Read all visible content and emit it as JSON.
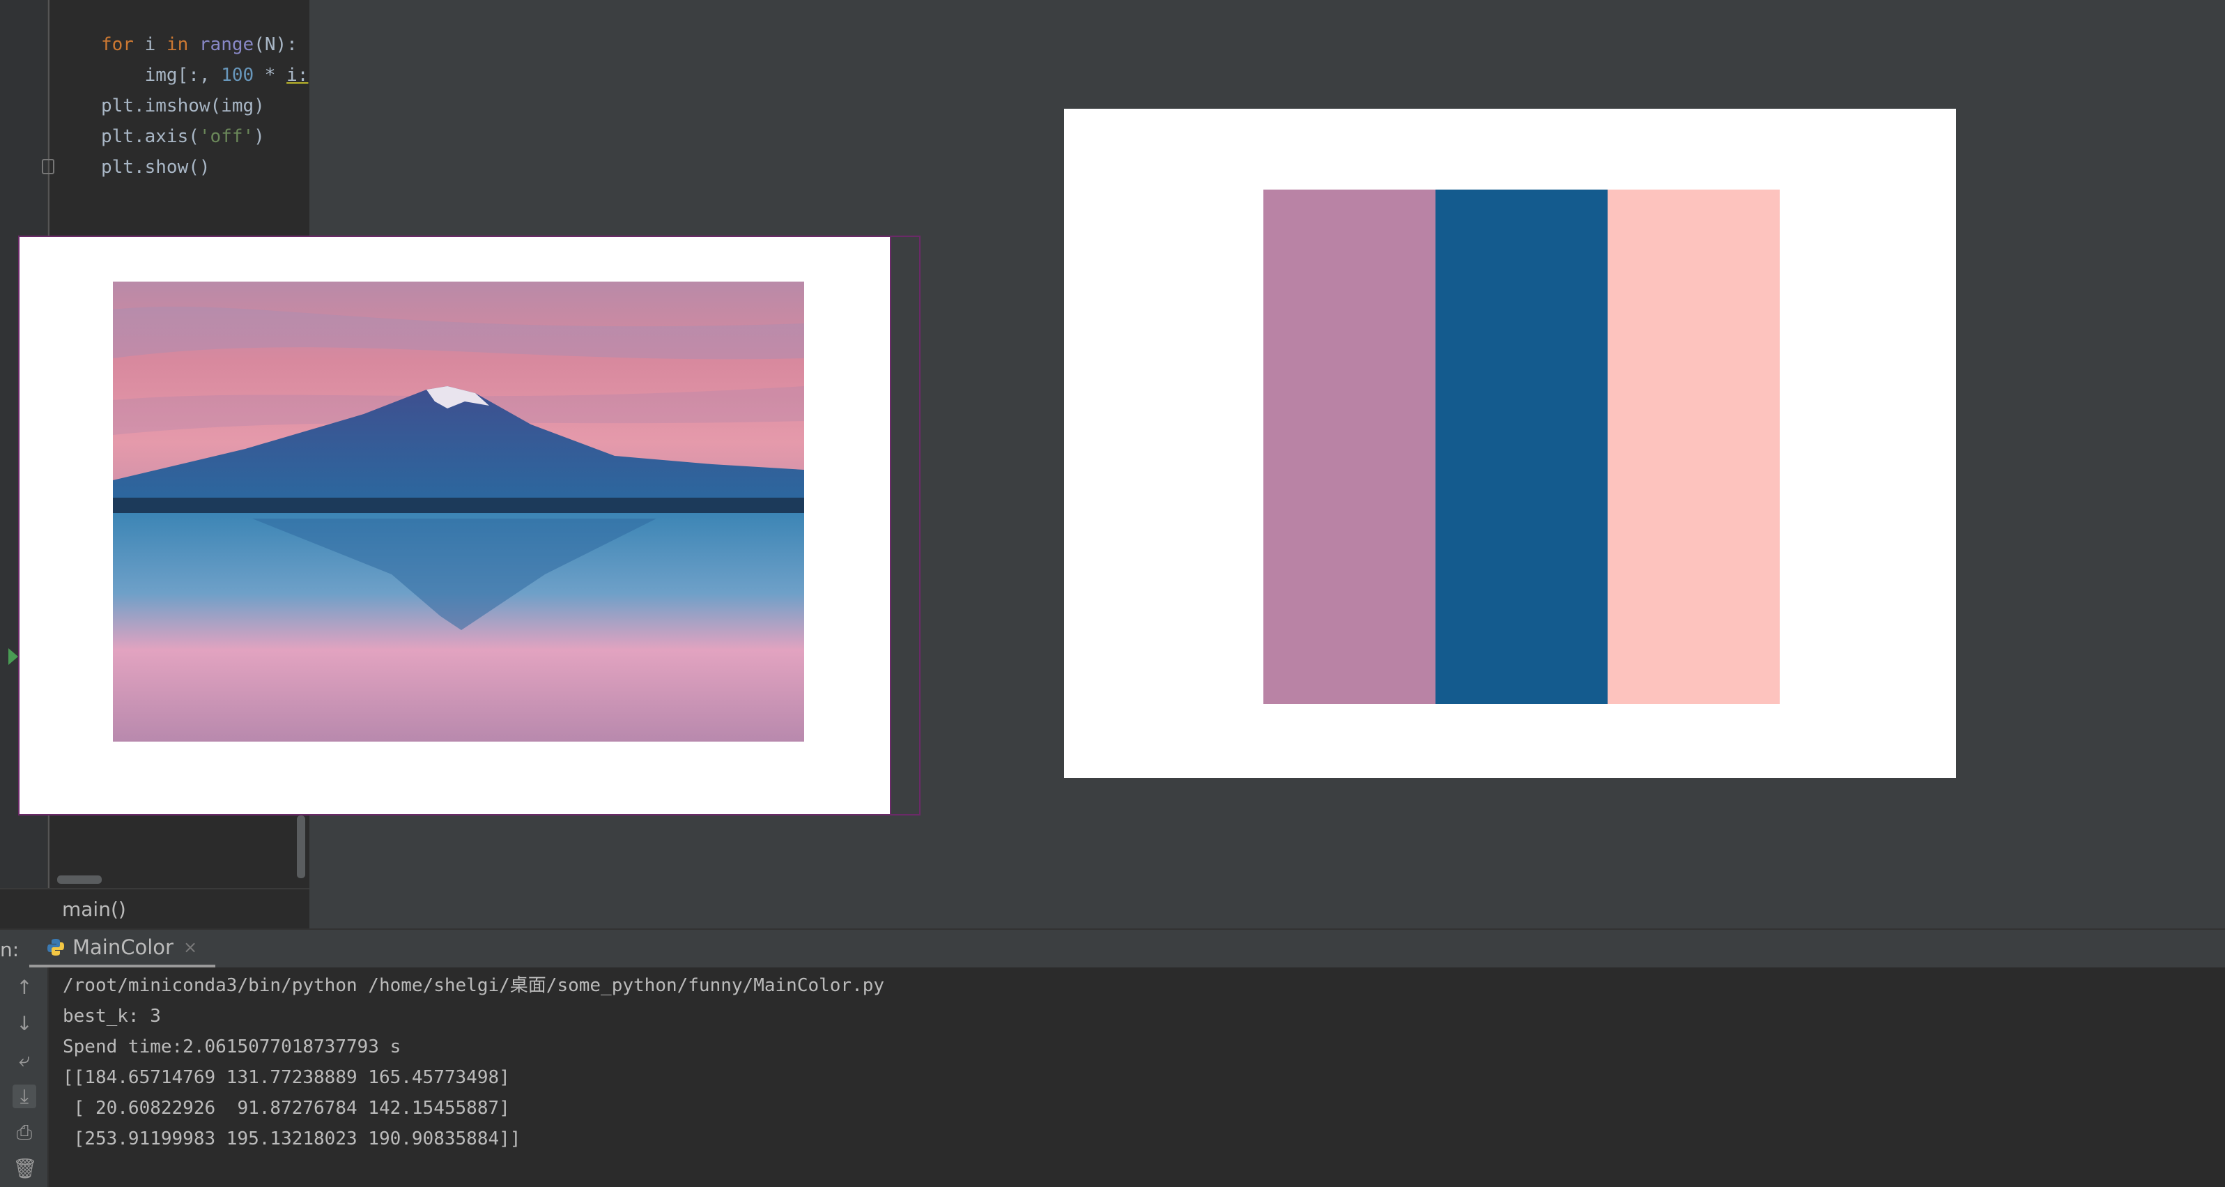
{
  "editor": {
    "code_lines": [
      [
        {
          "t": "for",
          "c": "kw"
        },
        {
          "t": " i ",
          "c": ""
        },
        {
          "t": "in",
          "c": "kw"
        },
        {
          "t": " ",
          "c": ""
        },
        {
          "t": "range",
          "c": "fn"
        },
        {
          "t": "(N):",
          "c": ""
        }
      ],
      [
        {
          "t": "    img[:, ",
          "c": ""
        },
        {
          "t": "100",
          "c": "num"
        },
        {
          "t": " * ",
          "c": ""
        },
        {
          "t": "i:",
          "c": "u"
        }
      ],
      [
        {
          "t": "plt.imshow(img)",
          "c": ""
        }
      ],
      [
        {
          "t": "plt.axis(",
          "c": ""
        },
        {
          "t": "'off'",
          "c": "str"
        },
        {
          "t": ")",
          "c": ""
        }
      ],
      [
        {
          "t": "plt.show()",
          "c": ""
        }
      ]
    ],
    "breadcrumb": "main()"
  },
  "figure_right": {
    "swatches": [
      "#b983a5",
      "#145b8e",
      "#fdc3be"
    ]
  },
  "run": {
    "label": "n:",
    "tab_label": "MainColor",
    "tab_close": "×",
    "console_lines": [
      "/root/miniconda3/bin/python /home/shelgi/桌面/some_python/funny/MainColor.py",
      "best_k: 3",
      "Spend time:2.0615077018737793 s",
      "[[184.65714769 131.77238889 165.45773498]",
      " [ 20.60822926  91.87276784 142.15455887]",
      " [253.91199983 195.13218023 190.90835884]]"
    ]
  },
  "icons": [
    "up-arrow-icon",
    "down-arrow-icon",
    "soft-wrap-icon",
    "scroll-to-end-icon",
    "print-icon",
    "trash-icon",
    "python-icon"
  ]
}
